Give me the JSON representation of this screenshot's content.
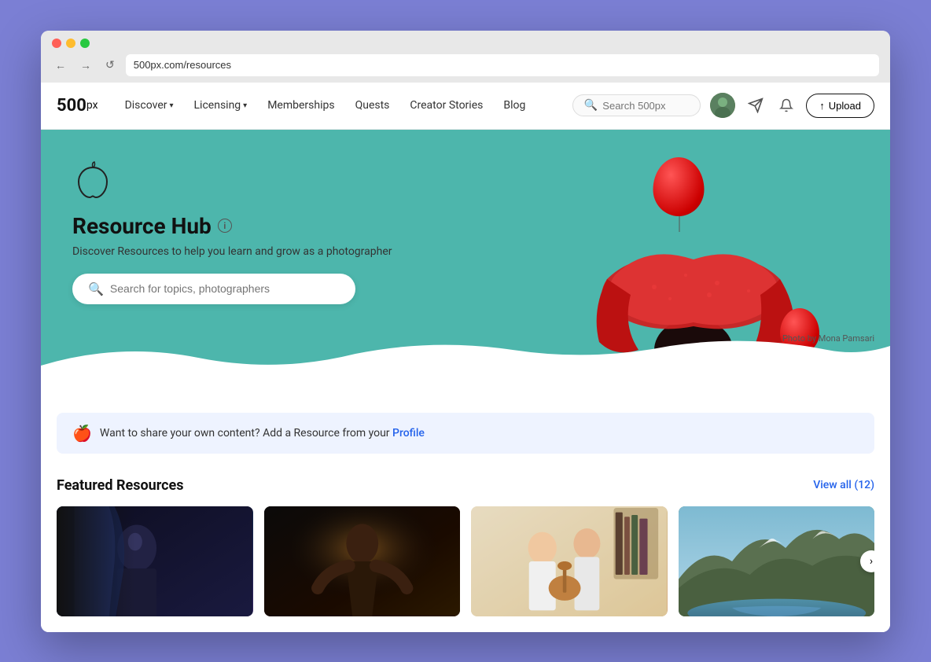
{
  "browser": {
    "address": "500px.com/resources",
    "back_btn": "←",
    "forward_btn": "→",
    "refresh_btn": "↺"
  },
  "nav": {
    "logo": "500",
    "logo_superscript": "px",
    "links": [
      {
        "label": "Discover",
        "has_dropdown": true
      },
      {
        "label": "Licensing",
        "has_dropdown": true
      },
      {
        "label": "Memberships",
        "has_dropdown": false
      },
      {
        "label": "Quests",
        "has_dropdown": false
      },
      {
        "label": "Creator Stories",
        "has_dropdown": false
      },
      {
        "label": "Blog",
        "has_dropdown": false
      }
    ],
    "search_placeholder": "Search 500px",
    "upload_label": "Upload"
  },
  "hero": {
    "title": "Resource Hub",
    "subtitle": "Discover Resources to help you learn and grow as a photographer",
    "search_placeholder": "Search for topics, photographers",
    "photo_credit": "Photo by Mona Pamsari"
  },
  "banner": {
    "text": "Want to share your own content? Add a Resource from your",
    "link_text": "Profile"
  },
  "featured": {
    "section_title": "Featured Resources",
    "view_all_label": "View all (12)",
    "cards": [
      {
        "id": 1,
        "alt": "Portrait photo with blue lighting"
      },
      {
        "id": 2,
        "alt": "Dark moody photography"
      },
      {
        "id": 3,
        "alt": "Couple playing guitar"
      },
      {
        "id": 4,
        "alt": "Mountain landscape with lake"
      }
    ]
  }
}
